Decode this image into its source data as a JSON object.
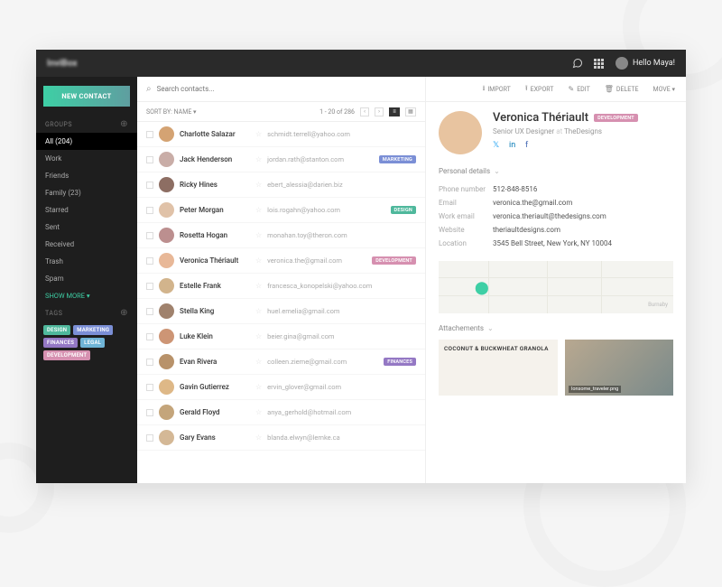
{
  "topbar": {
    "logo": "InviBox",
    "greeting": "Hello Maya!"
  },
  "sidebar": {
    "new_contact": "NEW CONTACT",
    "groups_label": "GROUPS",
    "groups": [
      {
        "label": "All (204)",
        "active": true
      },
      {
        "label": "Work"
      },
      {
        "label": "Friends"
      },
      {
        "label": "Family (23)"
      },
      {
        "label": "Starred"
      },
      {
        "label": "Sent"
      },
      {
        "label": "Received"
      },
      {
        "label": "Trash"
      },
      {
        "label": "Spam"
      }
    ],
    "show_more": "SHOW MORE ▾",
    "tags_label": "TAGS",
    "tags": [
      {
        "label": "DESIGN",
        "cls": "design"
      },
      {
        "label": "MARKETING",
        "cls": "marketing"
      },
      {
        "label": "FINANCES",
        "cls": "finances"
      },
      {
        "label": "LEGAL",
        "cls": "legal"
      },
      {
        "label": "DEVELOPMENT",
        "cls": "development"
      }
    ]
  },
  "search": {
    "placeholder": "Search contacts..."
  },
  "sort": {
    "label": "SORT BY: NAME ▾",
    "pager": "1 - 20 of 286"
  },
  "actions": {
    "import": "IMPORT",
    "export": "EXPORT",
    "edit": "EDIT",
    "delete": "DELETE",
    "move": "MOVE ▾"
  },
  "contacts": [
    {
      "name": "Charlotte Salazar",
      "email": "schmidt.terrell@yahoo.com",
      "av": "#d4a373"
    },
    {
      "name": "Jack Henderson",
      "email": "jordan.rath@stanton.com",
      "tag": "MARKETING",
      "tagcls": "marketing",
      "av": "#c9ada7"
    },
    {
      "name": "Ricky Hines",
      "email": "ebert_alessia@darien.biz",
      "av": "#8d6e63"
    },
    {
      "name": "Peter Morgan",
      "email": "lois.rogahn@yahoo.com",
      "tag": "DESIGN",
      "tagcls": "design",
      "av": "#e0c2a8"
    },
    {
      "name": "Rosetta Hogan",
      "email": "monahan.toy@theron.com",
      "av": "#bc8f8f"
    },
    {
      "name": "Veronica Thériault",
      "email": "veronica.the@gmail.com",
      "tag": "DEVELOPMENT",
      "tagcls": "development",
      "av": "#e8b898"
    },
    {
      "name": "Estelle Frank",
      "email": "francesca_konopelski@yahoo.com",
      "av": "#d2b48c"
    },
    {
      "name": "Stella King",
      "email": "huel.emelia@gmail.com",
      "av": "#a0826d"
    },
    {
      "name": "Luke Klein",
      "email": "beier.gina@gmail.com",
      "av": "#cd9575"
    },
    {
      "name": "Evan Rivera",
      "email": "colleen.zieme@gmail.com",
      "tag": "FINANCES",
      "tagcls": "finances",
      "av": "#b8926a"
    },
    {
      "name": "Gavin Gutierrez",
      "email": "ervin_glover@gmail.com",
      "av": "#deb887"
    },
    {
      "name": "Gerald Floyd",
      "email": "anya_gerhold@hotmail.com",
      "av": "#c4a57b"
    },
    {
      "name": "Gary Evans",
      "email": "blanda.elwyn@lemke.ca",
      "av": "#d4b896"
    }
  ],
  "profile": {
    "name": "Veronica Thériault",
    "tag": "DEVELOPMENT",
    "title_role": "Senior UX Designer",
    "title_at": "at",
    "title_company": "TheDesigns",
    "personal_details_label": "Personal details",
    "details": [
      {
        "label": "Phone number",
        "value": "512-848-8516"
      },
      {
        "label": "Email",
        "value": "veronica.the@gmail.com"
      },
      {
        "label": "Work email",
        "value": "veronica.theriault@thedesigns.com"
      },
      {
        "label": "Website",
        "value": "theriaultdesigns.com"
      },
      {
        "label": "Location",
        "value": "3545 Bell Street, New York, NY 10004"
      }
    ],
    "map_city": "Burnaby",
    "attachments_label": "Attachements",
    "att1_title": "COCONUT & BUCKWHEAT GRANOLA",
    "att2_label": "lonsome_traveler.png"
  }
}
